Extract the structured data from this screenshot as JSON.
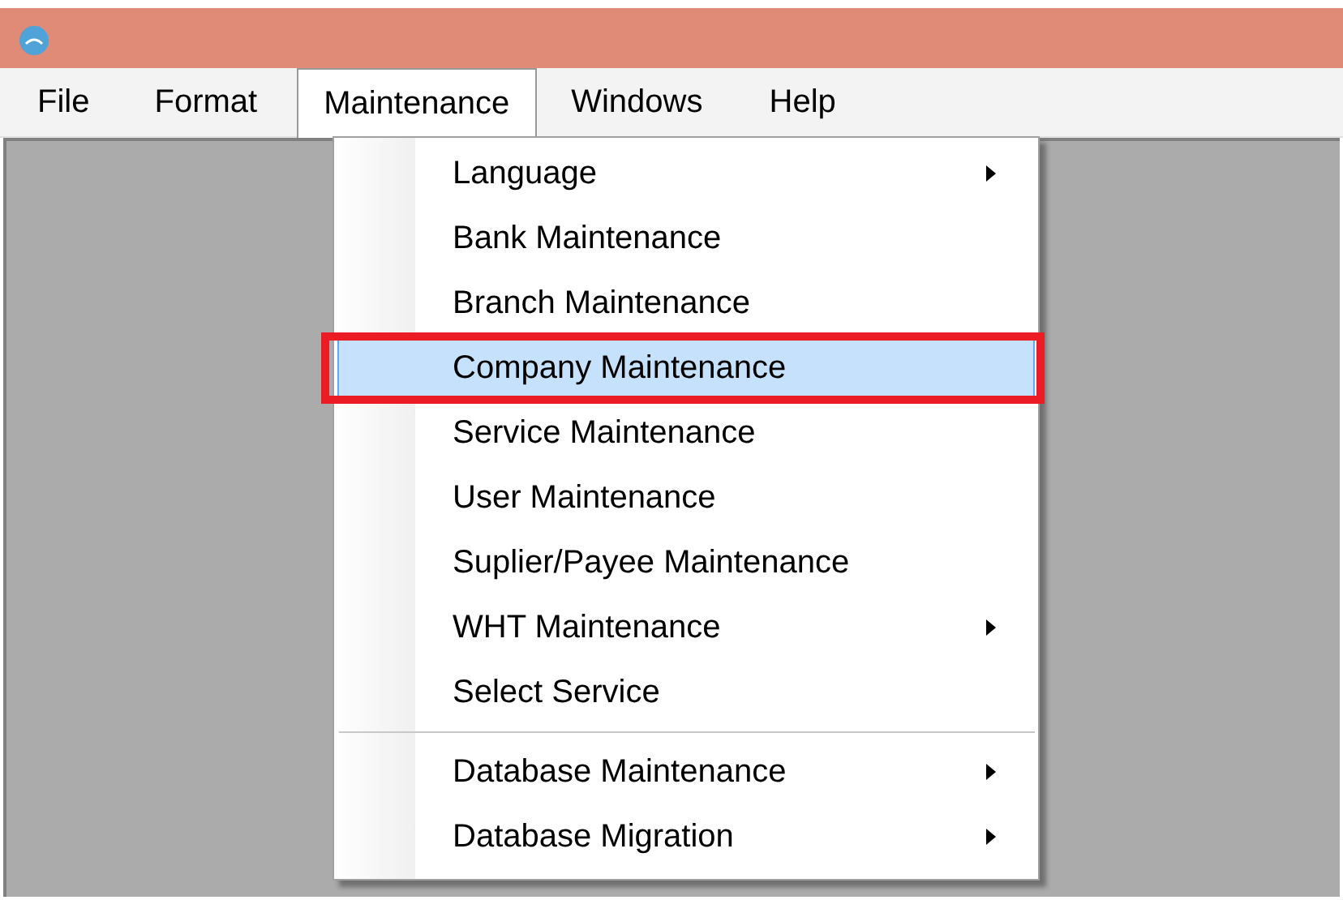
{
  "menu_bar": [
    {
      "label": "File",
      "selected": false
    },
    {
      "label": "Format",
      "selected": false
    },
    {
      "label": "Maintenance",
      "selected": true
    },
    {
      "label": "Windows",
      "selected": false
    },
    {
      "label": "Help",
      "selected": false
    }
  ],
  "dropdown": [
    {
      "kind": "item",
      "label": "Language",
      "submenu": true,
      "selected": false,
      "highlighted": false
    },
    {
      "kind": "item",
      "label": "Bank Maintenance",
      "submenu": false,
      "selected": false,
      "highlighted": false
    },
    {
      "kind": "item",
      "label": "Branch Maintenance",
      "submenu": false,
      "selected": false,
      "highlighted": false
    },
    {
      "kind": "item",
      "label": "Company Maintenance",
      "submenu": false,
      "selected": true,
      "highlighted": true
    },
    {
      "kind": "item",
      "label": "Service Maintenance",
      "submenu": false,
      "selected": false,
      "highlighted": false
    },
    {
      "kind": "item",
      "label": "User Maintenance",
      "submenu": false,
      "selected": false,
      "highlighted": false
    },
    {
      "kind": "item",
      "label": "Suplier/Payee Maintenance",
      "submenu": false,
      "selected": false,
      "highlighted": false
    },
    {
      "kind": "item",
      "label": "WHT Maintenance",
      "submenu": true,
      "selected": false,
      "highlighted": false
    },
    {
      "kind": "item",
      "label": "Select Service",
      "submenu": false,
      "selected": false,
      "highlighted": false
    },
    {
      "kind": "separator"
    },
    {
      "kind": "item",
      "label": "Database Maintenance",
      "submenu": true,
      "selected": false,
      "highlighted": false
    },
    {
      "kind": "item",
      "label": "Database Migration",
      "submenu": true,
      "selected": false,
      "highlighted": false
    }
  ]
}
